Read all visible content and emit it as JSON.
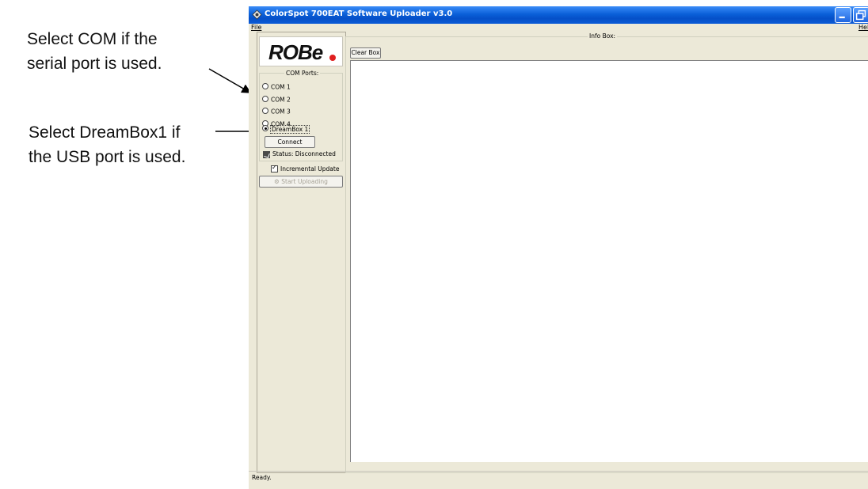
{
  "annotations": {
    "com_note": "Select COM if the serial port is used.",
    "dreambox_note": "Select DreamBox1 if the USB port is used."
  },
  "window": {
    "title": "ColorSpot 700EAT Software Uploader v3.0",
    "menu": {
      "file": "File",
      "help": "Help"
    }
  },
  "logo": {
    "text": "ROBe"
  },
  "com_ports": {
    "legend": "COM Ports:",
    "options": [
      "COM 1",
      "COM 2",
      "COM 3",
      "COM 4",
      "DreamBox 1"
    ],
    "selected": "DreamBox 1",
    "connect_label": "Connect",
    "status": "Status: Disconnected"
  },
  "incremental_update": {
    "label": "Incremental Update",
    "checked": true
  },
  "start_upload_label": "Start Uploading",
  "info_box": {
    "legend": "Info Box:",
    "clear_label": "Clear Box"
  },
  "status_bar": {
    "text": "Ready."
  },
  "colors": {
    "titlebar": "#0a5fd8",
    "window_bg": "#ece9d8",
    "close_button": "#c8391a",
    "logo_dot": "#e01f1f"
  }
}
